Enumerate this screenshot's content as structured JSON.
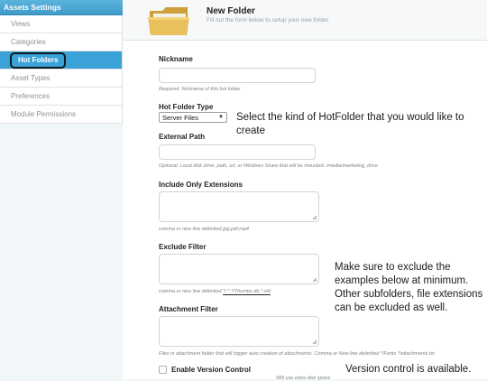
{
  "sidebar": {
    "header": "Assets Settings",
    "items": [
      {
        "label": "Views"
      },
      {
        "label": "Categories"
      },
      {
        "label": "Hot Folders",
        "active": true
      },
      {
        "label": "Asset Types"
      },
      {
        "label": "Preferences"
      },
      {
        "label": "Module Permissions"
      }
    ],
    "accent_color": "#3aa2d6"
  },
  "header": {
    "title": "New Folder",
    "subtitle": "Fill out the form below to setup your new folder.",
    "icon": "folder-icon"
  },
  "form": {
    "nickname": {
      "label": "Nickname",
      "value": "",
      "help": "Required. Nickname of this hot folder"
    },
    "hot_folder_type": {
      "label": "Hot Folder Type",
      "selected": "Server Files"
    },
    "external_path": {
      "label": "External Path",
      "value": "",
      "help": "Optional: Local disk drive, path, url, or Windows Share that will be mounted. /media/marketing_drive"
    },
    "include_extensions": {
      "label": "Include Only Extensions",
      "value": "",
      "help": "comma or new line delimited jpg,pdf,mp4"
    },
    "exclude_filter": {
      "label": "Exclude Filter",
      "value": "",
      "help_prefix": "comma or new line delimited",
      "help_example": "*/.*,*/Thumbs.db,*.old"
    },
    "attachment_filter": {
      "label": "Attachment Filter",
      "value": "",
      "help": "Files in attachment folder that will trigger auto creation of attachments. Comma or New line delimited */Fonts */attachments.txt"
    },
    "version_control": {
      "label": "Enable Version Control",
      "checked": false,
      "help": "Will use extra disk space"
    }
  },
  "annotations": {
    "type_note_line1": "Select the kind of HotFolder that you would like to",
    "type_note_line2": "create",
    "exclude_note_line1": "Make sure to exclude the",
    "exclude_note_line2": "examples below at minimum.",
    "exclude_note_line3": "Other subfolders, file extensions",
    "exclude_note_line4": "can be excluded as well.",
    "version_note": "Version control is available."
  }
}
